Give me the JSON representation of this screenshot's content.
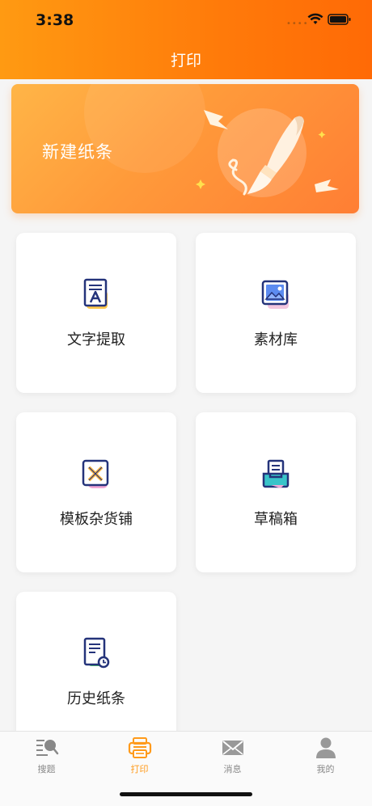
{
  "status": {
    "time": "3:38"
  },
  "header": {
    "title": "打印"
  },
  "banner": {
    "label": "新建纸条"
  },
  "tiles": [
    {
      "label": "文字提取",
      "icon": "text-extract-icon"
    },
    {
      "label": "素材库",
      "icon": "image-library-icon"
    },
    {
      "label": "模板杂货铺",
      "icon": "template-shop-icon"
    },
    {
      "label": "草稿箱",
      "icon": "draft-box-icon"
    },
    {
      "label": "历史纸条",
      "icon": "history-note-icon"
    }
  ],
  "tabbar": {
    "items": [
      {
        "label": "搜题",
        "icon": "search-question-icon",
        "active": false
      },
      {
        "label": "打印",
        "icon": "printer-icon",
        "active": true
      },
      {
        "label": "消息",
        "icon": "mail-icon",
        "active": false
      },
      {
        "label": "我的",
        "icon": "person-icon",
        "active": false
      }
    ]
  },
  "colors": {
    "accent": "#ff9a1a",
    "header_start": "#ff9a12",
    "header_end": "#ff6a06"
  }
}
